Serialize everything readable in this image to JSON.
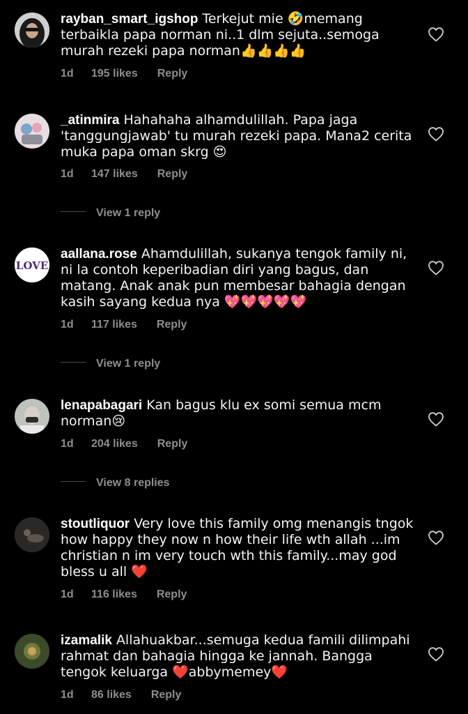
{
  "comments": [
    {
      "username": "rayban_smart_igshop",
      "text": "Terkejut mie 🤣memang terbaikla papa norman ni..1 dlm sejuta..semoga murah rezeki papa norman👍👍👍👍",
      "age": "1d",
      "likes": "195 likes",
      "reply": "Reply",
      "avatar_icon": "sunglasses-avatar"
    },
    {
      "username": "_atinmira",
      "text": "Hahahaha alhamdulillah. Papa jaga 'tanggungjawab' tu murah rezeki papa. Mana2 cerita muka papa oman skrg 😍",
      "age": "1d",
      "likes": "147 likes",
      "reply": "Reply",
      "view_replies": "View 1 reply",
      "avatar_icon": "cartoon-avatar"
    },
    {
      "username": "aallana.rose",
      "text": "Ahamdulillah, sukanya tengok family ni, ni la contoh keperibadian diri yang bagus, dan matang. Anak anak pun membesar bahagia dengan kasih sayang kedua nya 💖💖💖💖💖",
      "age": "1d",
      "likes": "117 likes",
      "reply": "Reply",
      "view_replies": "View 1 reply",
      "avatar_logo": "LOVE"
    },
    {
      "username": "lenapabagari",
      "text": "Kan bagus klu ex somi semua mcm norman😢",
      "age": "1d",
      "likes": "204 likes",
      "reply": "Reply",
      "view_replies": "View 8 replies",
      "avatar_icon": "masked-person-avatar"
    },
    {
      "username": "stoutliquor",
      "text": "Very love this family omg menangis tngok how happy they now n how their life wth allah ...im christian n im very touch wth this family...may god bless u all ❤️",
      "age": "1d",
      "likes": "116 likes",
      "reply": "Reply",
      "avatar_icon": "dark-photo-avatar"
    },
    {
      "username": "izamalik",
      "text": "Allahuakbar...semuga kedua  famili dilimpahi rahmat dan bahagia hingga ke jannah.  Bangga tengok keluarga ❤️abbymemey❤️",
      "age": "1d",
      "likes": "86 likes",
      "reply": "Reply",
      "avatar_icon": "nature-avatar"
    }
  ],
  "colors": {
    "background": "#000000",
    "text": "#f5f5f5",
    "meta": "#8e8e8e",
    "divider": "#4a4a4a"
  }
}
